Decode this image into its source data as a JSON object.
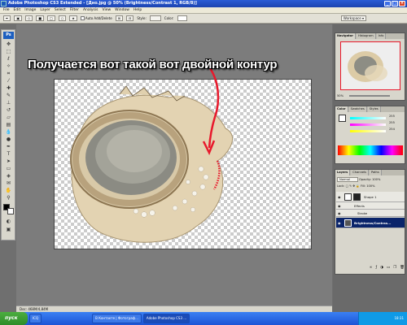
{
  "window": {
    "title": "Adobe Photoshop CS3 Extended - [Дно.jpg @ 50% (Brightness/Contrast 1, RGB/8)]",
    "minimize": "_",
    "maximize": "□",
    "close": "×"
  },
  "menu": [
    "File",
    "Edit",
    "Image",
    "Layer",
    "Select",
    "Filter",
    "Analysis",
    "View",
    "Window",
    "Help"
  ],
  "options_bar": {
    "auto_add_delete": "Auto Add/Delete",
    "style_label": "Style:",
    "color_label": "Color:",
    "workspace": "Workspace"
  },
  "toolbox": {
    "logo": "Ps"
  },
  "document": {
    "caption": "Получается вот такой вот двойной контур",
    "status": "Doc: 468M/4,84M"
  },
  "panels": {
    "navigator_tabs": [
      "Navigator",
      "Histogram",
      "Info"
    ],
    "zoom": "50%",
    "color_tabs": [
      "Color",
      "Swatches",
      "Styles"
    ],
    "color_values": {
      "r": "255",
      "g": "255",
      "b": "254"
    },
    "layers_tabs": [
      "Layers",
      "Channels",
      "Paths"
    ],
    "blend_mode": "Normal",
    "opacity_label": "Opacity:",
    "opacity": "100%",
    "lock_label": "Lock:",
    "fill_label": "Fill:",
    "fill": "100%",
    "layers": [
      {
        "name": "Shape 1"
      },
      {
        "name": "Effects"
      },
      {
        "name": "Stroke"
      },
      {
        "name": "Brightness/Contras..."
      }
    ]
  },
  "taskbar": {
    "start": "пуск",
    "buttons": [
      "ICQ",
      "В Контакте | Фотограф...",
      "Adobe Photoshop CS3 ..."
    ],
    "clock": "18:31"
  },
  "colors": {
    "annotation_arrow": "#e8192c",
    "titlebar": "#1e48b8",
    "taskbar": "#2a63e0"
  }
}
